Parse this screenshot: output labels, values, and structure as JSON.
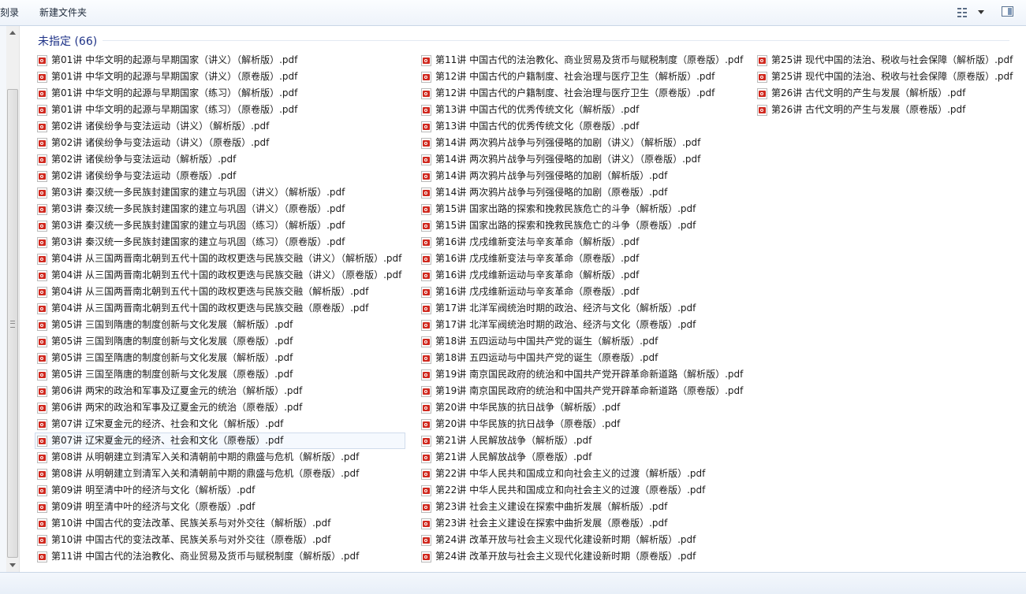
{
  "toolbar": {
    "burn_label": "刻录",
    "new_folder_label": "新建文件夹",
    "view_icon": "grid-view-icon",
    "preview_icon": "preview-pane-icon"
  },
  "group": {
    "title": "未指定 (66)"
  },
  "files": {
    "col1": [
      "第01讲 中华文明的起源与早期国家（讲义）（解析版）.pdf",
      "第01讲 中华文明的起源与早期国家（讲义）（原卷版）.pdf",
      "第01讲 中华文明的起源与早期国家（练习）（解析版）.pdf",
      "第01讲 中华文明的起源与早期国家（练习）（原卷版）.pdf",
      "第02讲 诸侯纷争与变法运动（讲义）（解析版）.pdf",
      "第02讲 诸侯纷争与变法运动（讲义）（原卷版）.pdf",
      "第02讲 诸侯纷争与变法运动（解析版）.pdf",
      "第02讲 诸侯纷争与变法运动（原卷版）.pdf",
      "第03讲 秦汉统一多民族封建国家的建立与巩固（讲义）（解析版）.pdf",
      "第03讲 秦汉统一多民族封建国家的建立与巩固（讲义）（原卷版）.pdf",
      "第03讲 秦汉统一多民族封建国家的建立与巩固（练习）（解析版）.pdf",
      "第03讲 秦汉统一多民族封建国家的建立与巩固（练习）（原卷版）.pdf",
      "第04讲 从三国两晋南北朝到五代十国的政权更迭与民族交融（讲义）（解析版）.pdf",
      "第04讲 从三国两晋南北朝到五代十国的政权更迭与民族交融（讲义）（原卷版）.pdf",
      "第04讲 从三国两晋南北朝到五代十国的政权更迭与民族交融（解析版）.pdf",
      "第04讲 从三国两晋南北朝到五代十国的政权更迭与民族交融（原卷版）.pdf",
      "第05讲 三国到隋唐的制度创新与文化发展（解析版）.pdf",
      "第05讲 三国到隋唐的制度创新与文化发展（原卷版）.pdf",
      "第05讲 三国至隋唐的制度创新与文化发展（解析版）.pdf",
      "第05讲 三国至隋唐的制度创新与文化发展（原卷版）.pdf",
      "第06讲 两宋的政治和军事及辽夏金元的统治（解析版）.pdf",
      "第06讲 两宋的政治和军事及辽夏金元的统治（原卷版）.pdf",
      "第07讲 辽宋夏金元的经济、社会和文化（解析版）.pdf",
      "第07讲 辽宋夏金元的经济、社会和文化（原卷版）.pdf",
      "第08讲 从明朝建立到清军入关和清朝前中期的鼎盛与危机（解析版）.pdf",
      "第08讲 从明朝建立到清军入关和清朝前中期的鼎盛与危机（原卷版）.pdf",
      "第09讲 明至清中叶的经济与文化（解析版）.pdf",
      "第09讲 明至清中叶的经济与文化（原卷版）.pdf",
      "第10讲 中国古代的变法改革、民族关系与对外交往（解析版）.pdf",
      "第10讲 中国古代的变法改革、民族关系与对外交往（原卷版）.pdf",
      "第11讲 中国古代的法治教化、商业贸易及货币与赋税制度（解析版）.pdf"
    ],
    "col2": [
      "第11讲 中国古代的法治教化、商业贸易及货币与赋税制度（原卷版）.pdf",
      "第12讲 中国古代的户籍制度、社会治理与医疗卫生（解析版）.pdf",
      "第12讲 中国古代的户籍制度、社会治理与医疗卫生（原卷版）.pdf",
      "第13讲 中国古代的优秀传统文化（解析版）.pdf",
      "第13讲 中国古代的优秀传统文化（原卷版）.pdf",
      "第14讲 两次鸦片战争与列强侵略的加剧（讲义）（解析版）.pdf",
      "第14讲 两次鸦片战争与列强侵略的加剧（讲义）（原卷版）.pdf",
      "第14讲 两次鸦片战争与列强侵略的加剧（解析版）.pdf",
      "第14讲 两次鸦片战争与列强侵略的加剧（原卷版）.pdf",
      "第15讲 国家出路的探索和挽救民族危亡的斗争（解析版）.pdf",
      "第15讲 国家出路的探索和挽救民族危亡的斗争（原卷版）.pdf",
      "第16讲 戊戌维新变法与辛亥革命（解析版）.pdf",
      "第16讲 戊戌维新变法与辛亥革命（原卷版）.pdf",
      "第16讲 戊戌维新运动与辛亥革命（解析版）.pdf",
      "第16讲 戊戌维新运动与辛亥革命（原卷版）.pdf",
      "第17讲 北洋军阀统治时期的政治、经济与文化（解析版）.pdf",
      "第17讲 北洋军阀统治时期的政治、经济与文化（原卷版）.pdf",
      "第18讲 五四运动与中国共产党的诞生（解析版）.pdf",
      "第18讲 五四运动与中国共产党的诞生（原卷版）.pdf",
      "第19讲 南京国民政府的统治和中国共产党开辟革命新道路（解析版）.pdf",
      "第19讲 南京国民政府的统治和中国共产党开辟革命新道路（原卷版）.pdf",
      "第20讲 中华民族的抗日战争（解析版）.pdf",
      "第20讲 中华民族的抗日战争（原卷版）.pdf",
      "第21讲 人民解放战争（解析版）.pdf",
      "第21讲 人民解放战争（原卷版）.pdf",
      "第22讲 中华人民共和国成立和向社会主义的过渡（解析版）.pdf",
      "第22讲 中华人民共和国成立和向社会主义的过渡（原卷版）.pdf",
      "第23讲 社会主义建设在探索中曲折发展（解析版）.pdf",
      "第23讲 社会主义建设在探索中曲折发展（原卷版）.pdf",
      "第24讲 改革开放与社会主义现代化建设新时期（解析版）.pdf",
      "第24讲 改革开放与社会主义现代化建设新时期（原卷版）.pdf"
    ],
    "col3": [
      "第25讲 现代中国的法治、税收与社会保障（解析版）.pdf",
      "第25讲 现代中国的法治、税收与社会保障（原卷版）.pdf",
      "第26讲 古代文明的产生与发展（解析版）.pdf",
      "第26讲 古代文明的产生与发展（原卷版）.pdf"
    ]
  }
}
